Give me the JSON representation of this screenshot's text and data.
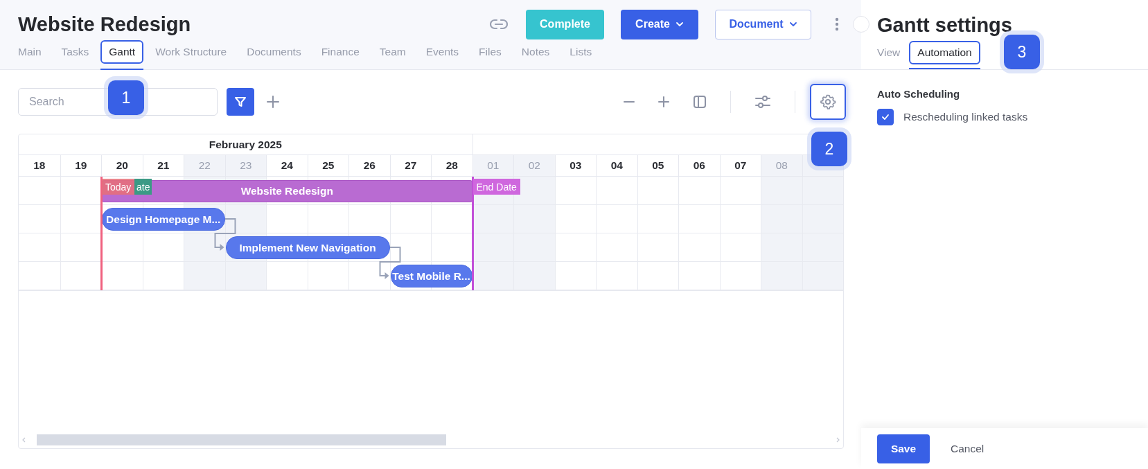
{
  "header": {
    "title": "Website Redesign",
    "complete_button": "Complete",
    "create_button": "Create",
    "document_button": "Document"
  },
  "tabs": [
    {
      "label": "Main",
      "selected": false,
      "highlighted": false
    },
    {
      "label": "Tasks",
      "selected": false,
      "highlighted": false
    },
    {
      "label": "Gantt",
      "selected": true,
      "highlighted": true
    },
    {
      "label": "Work Structure",
      "selected": false,
      "highlighted": false
    },
    {
      "label": "Documents",
      "selected": false,
      "highlighted": false
    },
    {
      "label": "Finance",
      "selected": false,
      "highlighted": false
    },
    {
      "label": "Team",
      "selected": false,
      "highlighted": false
    },
    {
      "label": "Events",
      "selected": false,
      "highlighted": false
    },
    {
      "label": "Files",
      "selected": false,
      "highlighted": false
    },
    {
      "label": "Notes",
      "selected": false,
      "highlighted": false
    },
    {
      "label": "Lists",
      "selected": false,
      "highlighted": false
    }
  ],
  "toolbar": {
    "search": {
      "placeholder": "Search"
    },
    "settings_highlighted": true
  },
  "gantt": {
    "month": "February 2025",
    "days": [
      {
        "label": "18",
        "weekend": false
      },
      {
        "label": "19",
        "weekend": false
      },
      {
        "label": "20",
        "weekend": false
      },
      {
        "label": "21",
        "weekend": false
      },
      {
        "label": "22",
        "weekend": true
      },
      {
        "label": "23",
        "weekend": true
      },
      {
        "label": "24",
        "weekend": false
      },
      {
        "label": "25",
        "weekend": false
      },
      {
        "label": "26",
        "weekend": false
      },
      {
        "label": "27",
        "weekend": false
      },
      {
        "label": "28",
        "weekend": false
      },
      {
        "label": "01",
        "weekend": true
      },
      {
        "label": "02",
        "weekend": true
      },
      {
        "label": "03",
        "weekend": false
      },
      {
        "label": "04",
        "weekend": false
      },
      {
        "label": "05",
        "weekend": false
      },
      {
        "label": "06",
        "weekend": false
      },
      {
        "label": "07",
        "weekend": false
      },
      {
        "label": "08",
        "weekend": true
      },
      {
        "weekend": true
      }
    ],
    "rows": [
      {
        "kind": "summary",
        "label": "Website Redesign"
      },
      {
        "kind": "task",
        "label": "Design Homepage M..."
      },
      {
        "kind": "task",
        "label": "Implement New Navigation"
      },
      {
        "kind": "task",
        "label": "Test Mobile R..."
      }
    ],
    "markers": [
      {
        "kind": "today",
        "label": "Today"
      },
      {
        "kind": "start",
        "label": "ate"
      },
      {
        "kind": "end",
        "label": "End Date"
      }
    ]
  },
  "settings": {
    "title": "Gantt settings",
    "tabs": [
      {
        "label": "View",
        "selected": false,
        "highlighted": false
      },
      {
        "label": "Automation",
        "selected": true,
        "highlighted": true
      }
    ],
    "section": "Auto Scheduling",
    "options": [
      {
        "label": "Rescheduling linked tasks",
        "checked": true
      }
    ],
    "save_button": "Save",
    "cancel_button": "Cancel"
  },
  "callouts": [
    {
      "label": "1"
    },
    {
      "label": "2"
    },
    {
      "label": "3"
    }
  ]
}
